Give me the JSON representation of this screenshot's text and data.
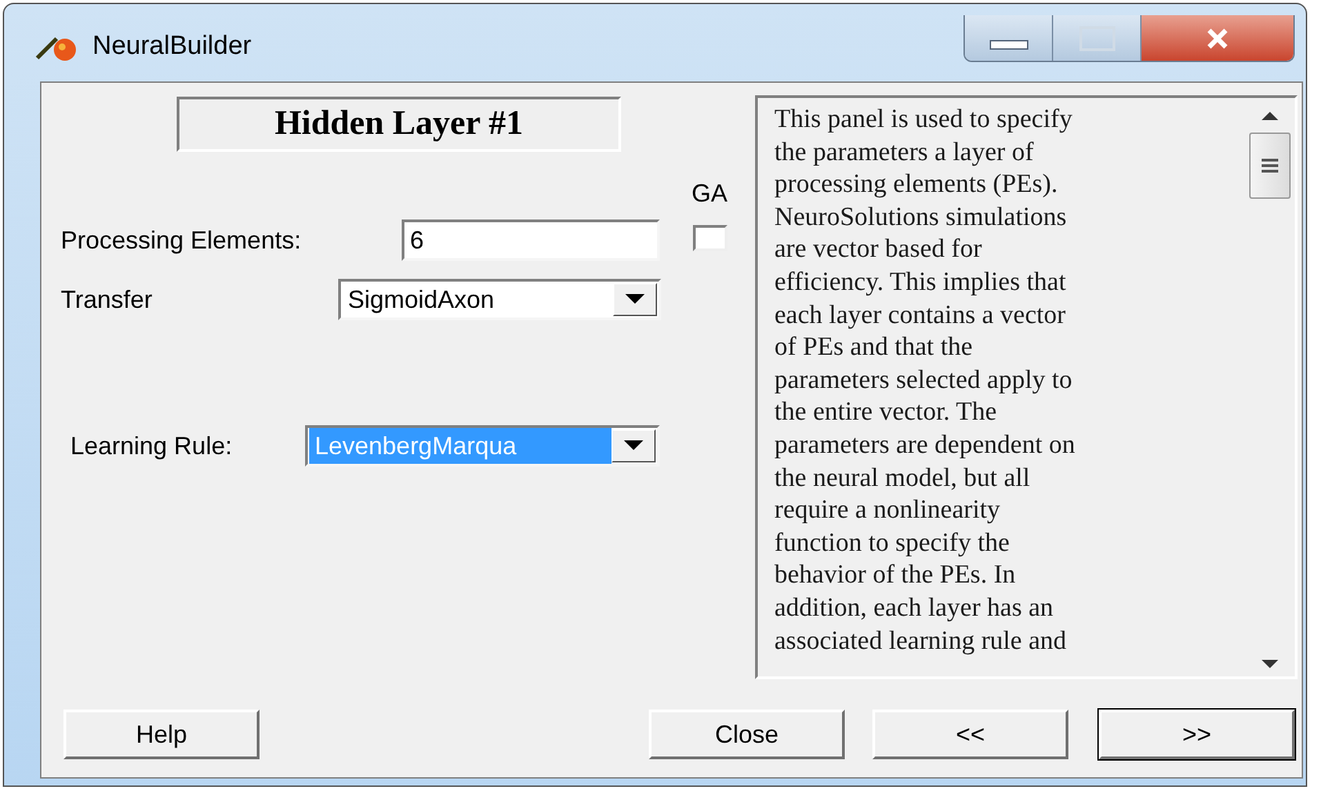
{
  "window": {
    "title": "NeuralBuilder"
  },
  "heading": "Hidden Layer #1",
  "ga": {
    "label": "GA",
    "checked": false
  },
  "fields": [
    {
      "kind": "text",
      "label": "Processing Elements:",
      "value": "6"
    },
    {
      "kind": "select",
      "label": "Transfer",
      "value": "SigmoidAxon"
    },
    {
      "kind": "select",
      "label": "Learning Rule:",
      "value": "LevenbergMarqua",
      "highlighted": true
    }
  ],
  "help_text_lines": [
    "This panel is used to specify",
    "the parameters a layer of",
    "processing elements (PEs).",
    "NeuroSolutions simulations",
    "are vector based for",
    "efficiency. This implies that",
    "each layer contains a vector",
    "of PEs and that the",
    "parameters selected apply to",
    "the entire vector. The",
    "parameters are dependent on",
    "the neural model, but all",
    "require a nonlinearity",
    "function to specify the",
    "behavior of the PEs. In",
    "addition, each layer has an",
    "associated learning rule and"
  ],
  "buttons": [
    {
      "label": "Help",
      "kind": "plain"
    },
    {
      "label": "Close",
      "kind": "plain"
    },
    {
      "label": "<<",
      "kind": "plain"
    },
    {
      "label": ">>",
      "kind": "default"
    }
  ]
}
